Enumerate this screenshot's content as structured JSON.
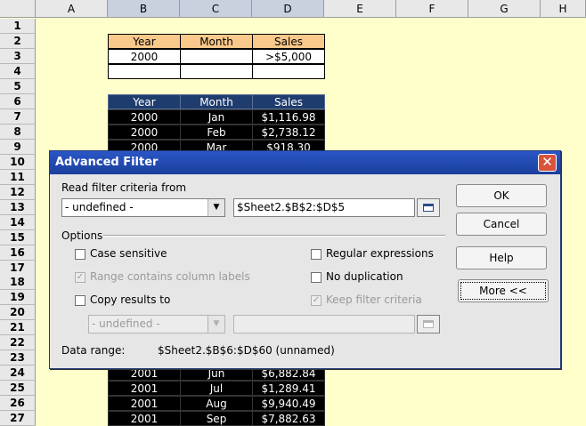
{
  "spreadsheet": {
    "columns": [
      "A",
      "B",
      "C",
      "D",
      "E",
      "F",
      "G",
      "H"
    ],
    "rows": [
      "1",
      "2",
      "3",
      "4",
      "5",
      "6",
      "7",
      "8",
      "9",
      "10",
      "11",
      "12",
      "13",
      "14",
      "15",
      "16",
      "17",
      "18",
      "19",
      "20",
      "21",
      "22",
      "23",
      "24",
      "25",
      "26",
      "27"
    ],
    "criteria_header": [
      "Year",
      "Month",
      "Sales"
    ],
    "criteria_row": [
      "2000",
      "",
      ">$5,000"
    ],
    "data_header": [
      "Year",
      "Month",
      "Sales"
    ],
    "data_rows_top": [
      [
        "2000",
        "Jan",
        "$1,116.98"
      ],
      [
        "2000",
        "Feb",
        "$2,738.12"
      ],
      [
        "2000",
        "Mar",
        "$918.30"
      ]
    ],
    "data_rows_bottom": [
      [
        "2001",
        "Jun",
        "$6,882.84"
      ],
      [
        "2001",
        "Jul",
        "$1,289.41"
      ],
      [
        "2001",
        "Aug",
        "$9,940.49"
      ],
      [
        "2001",
        "Sep",
        "$7,882.63"
      ]
    ]
  },
  "dialog": {
    "title": "Advanced Filter",
    "close_glyph": "✕",
    "read_from_label": "Read filter criteria from",
    "source_combo_value": "- undefined -",
    "source_range_value": "$Sheet2.$B$2:$D$5",
    "options_label": "Options",
    "case_sensitive": "Case sensitive",
    "range_contains_labels": "Range contains column labels",
    "copy_results_to": "Copy results to",
    "copy_combo_value": "- undefined -",
    "copy_range_value": "",
    "regular_expressions": "Regular expressions",
    "no_duplication": "No duplication",
    "keep_filter_criteria": "Keep filter criteria",
    "data_range_label": "Data range:",
    "data_range_value": "$Sheet2.$B$6:$D$60 (unnamed)",
    "buttons": {
      "ok": "OK",
      "cancel": "Cancel",
      "help": "Help",
      "more": "More <<"
    },
    "checked_glyph": "✓",
    "arrow_glyph": "▼",
    "colors": {
      "titlebar": "#1b3f9d",
      "close": "#d9533c"
    }
  }
}
